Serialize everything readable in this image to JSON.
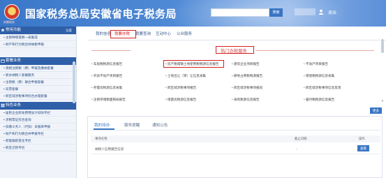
{
  "header": {
    "site_title": "国家税务总局安徽省电子税务局",
    "logo_caption": "安徽税务",
    "search_button": "搜索",
    "logout": "退出"
  },
  "sidebar": {
    "common_title": "常用功能",
    "common_more": "设置",
    "common_items": [
      "• 主税种增值税一表集成",
      "• 财产和行为税合并纳税申报"
    ],
    "report_title": "套餐业务",
    "report_items": [
      "• 清税注销税（费）申报及缴纳套餐",
      "• 新办纳税人套餐服务",
      "• 注销税（费）联合申报套餐",
      "• 双票套餐",
      "• 跨区域涉税事项综合办理套餐"
    ],
    "special_title": "特色业务",
    "special_items": [
      "• 居民企业研发费用加计扣除专栏",
      "• 涉税票证综合查询",
      "• 扣缴义务人（代扣）日报单申报",
      "• 财产和行为税合并申报专栏",
      "• 新版跟踪变化专栏",
      "• 跨区迁移专栏"
    ]
  },
  "tabs": [
    "我的信息",
    "我要办税",
    "我要查询",
    "互动中心",
    "公众服务"
  ],
  "active_tab_index": 1,
  "hot": {
    "title": "热门办税服务",
    "rows": [
      [
        "车船税税源信息报告",
        "房产税城镇土地使用税税源信息报告",
        "建筑企业项目报告",
        "不动产项目报告"
      ],
      [
        "开具不动产项目报告",
        "土地出让（转）让信息采集",
        "耕地占用税税源报告",
        "增值税税源信息采集"
      ],
      [
        "存量房税源信息采集",
        "跨区域涉税事项报告",
        "跨区域涉税事项报验",
        "跨区域涉税事项信息反馈"
      ],
      [
        "注销存储税面税局报告",
        "增量房税源信息报告",
        "采购税源信息报告",
        "临时税税源信息报告"
      ]
    ],
    "more_button": "更多"
  },
  "lower": {
    "tabs": [
      "我的待办",
      "服务提醒",
      "通知公告"
    ],
    "columns": [
      "事项名称",
      "截止日期",
      "操作"
    ],
    "rows": [
      {
        "name": "纳税人信用报告信息",
        "deadline": "-",
        "action": "查看"
      }
    ]
  }
}
